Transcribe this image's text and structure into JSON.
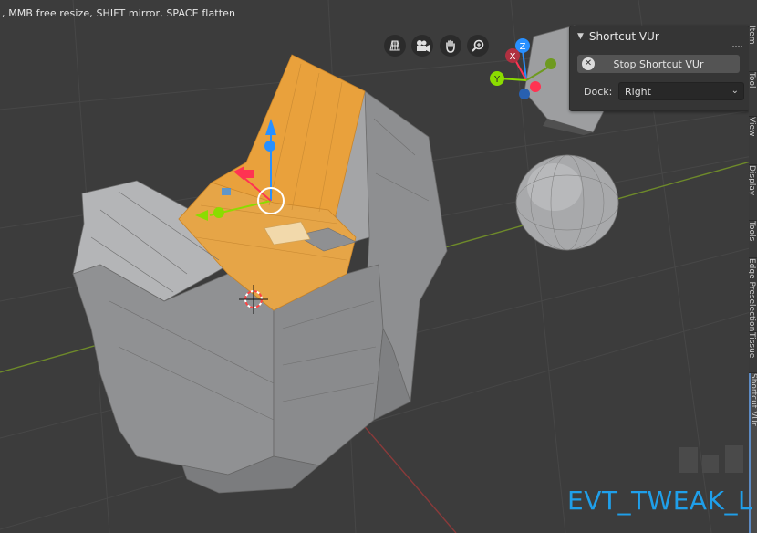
{
  "viewport": {
    "hint_text": ", MMB free resize, SHIFT mirror, SPACE flatten",
    "event_text": "EVT_TWEAK_L",
    "gizmo_axes": [
      "Z",
      "X",
      "Y"
    ]
  },
  "nav_buttons": [
    {
      "name": "perspective-grid-icon"
    },
    {
      "name": "camera-icon"
    },
    {
      "name": "hand-pan-icon"
    },
    {
      "name": "zoom-icon"
    }
  ],
  "panel": {
    "title": "Shortcut VUr",
    "stop_label": "Stop Shortcut VUr",
    "dock_label": "Dock:",
    "dock_value": "Right"
  },
  "side_tabs": [
    "Item",
    "Tool",
    "View",
    "Display",
    "Tools",
    "Edge Preselection",
    "Tissue",
    "Shortcut VUr"
  ],
  "colors": {
    "selected_face": "#e9a13c",
    "mesh_face": "#999a9c",
    "x_axis": "#ff3352",
    "y_axis": "#8bdc00",
    "z_axis": "#2890ff",
    "event_text": "#1f9fea"
  }
}
